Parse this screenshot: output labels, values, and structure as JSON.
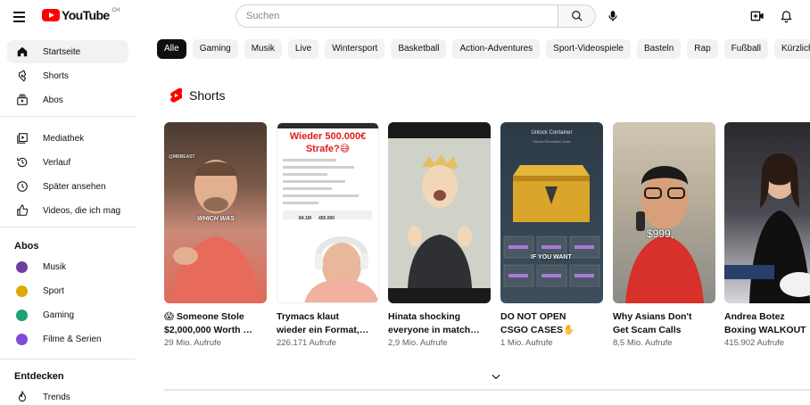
{
  "header": {
    "logo_text": "YouTube",
    "country_code": "CH",
    "search_placeholder": "Suchen"
  },
  "sidebar": {
    "main": [
      {
        "label": "Startseite",
        "icon": "home-icon",
        "active": true
      },
      {
        "label": "Shorts",
        "icon": "shorts-icon"
      },
      {
        "label": "Abos",
        "icon": "subscriptions-icon"
      }
    ],
    "library": [
      {
        "label": "Mediathek",
        "icon": "library-icon"
      },
      {
        "label": "Verlauf",
        "icon": "history-icon"
      },
      {
        "label": "Später ansehen",
        "icon": "watch-later-icon"
      },
      {
        "label": "Videos, die ich mag",
        "icon": "thumbs-up-icon"
      }
    ],
    "subs_heading": "Abos",
    "subs": [
      {
        "label": "Musik",
        "color": "#6b3fa0"
      },
      {
        "label": "Sport",
        "color": "#e0a800"
      },
      {
        "label": "Gaming",
        "color": "#1aa37a"
      },
      {
        "label": "Filme & Serien",
        "color": "#7b4dd6"
      }
    ],
    "explore_heading": "Entdecken",
    "explore": [
      {
        "label": "Trends",
        "icon": "trending-icon"
      }
    ]
  },
  "chips": [
    "Alle",
    "Gaming",
    "Musik",
    "Live",
    "Wintersport",
    "Basketball",
    "Action-Adventures",
    "Sport-Videospiele",
    "Basteln",
    "Rap",
    "Fußball",
    "Kürzlich hochgeladen"
  ],
  "shorts": {
    "title": "Shorts",
    "items": [
      {
        "title1": "😱 Someone Stole",
        "title2": "$2,000,000 Worth …",
        "views": "29 Mio. Aufrufe",
        "overlay": "WHICH WAS",
        "handle": "@MRBEAST"
      },
      {
        "title1": "Trymacs klaut",
        "title2": "wieder ein Format,…",
        "views": "226.171 Aufrufe",
        "overlay1": "Wieder 500.000€",
        "overlay2": "Strafe?😅",
        "stat1": "84.1M",
        "stat2": "455.000"
      },
      {
        "title1": "Hinata shocking",
        "title2": "everyone in match…",
        "views": "2,9 Mio. Aufrufe"
      },
      {
        "title1": "DO NOT OPEN",
        "title2": "CSGO CASES✋",
        "views": "1 Mio. Aufrufe",
        "overlay1": "Unlock Container",
        "overlay2": "Unlock Revolution Case",
        "overlay3": "IF YOU WANT"
      },
      {
        "title1": "Why Asians Don't",
        "title2": "Get Scam Calls",
        "views": "8,5 Mio. Aufrufe",
        "overlay": "$999,"
      },
      {
        "title1": "Andrea Botez",
        "title2": "Boxing WALKOUT",
        "views": "415.902 Aufrufe"
      }
    ]
  }
}
